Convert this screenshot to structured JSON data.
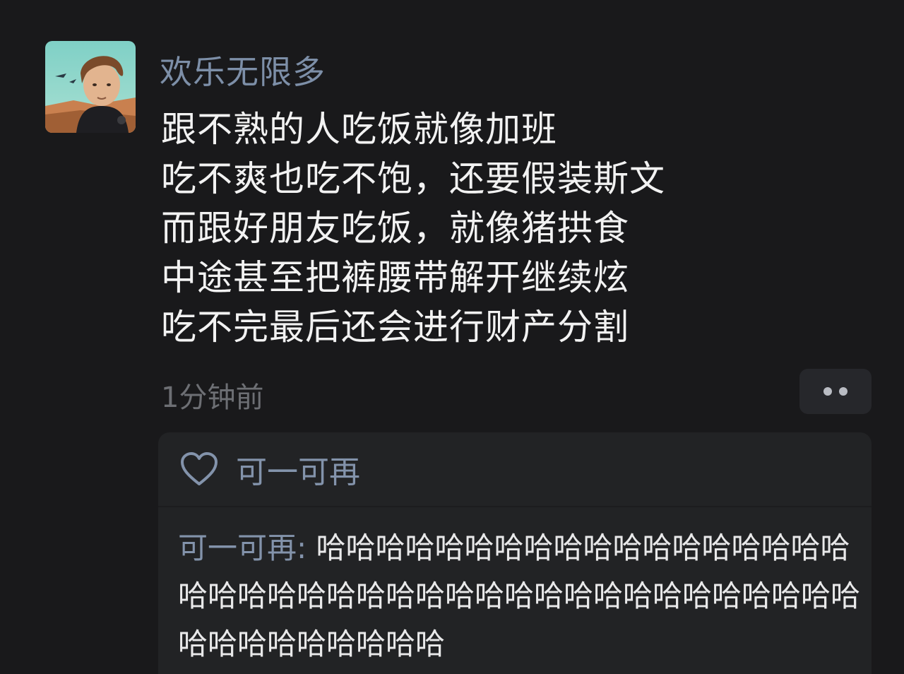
{
  "post": {
    "username": "欢乐无限多",
    "lines": [
      "跟不熟的人吃饭就像加班",
      "吃不爽也吃不饱，还要假装斯文",
      "而跟好朋友吃饭，就像猪拱食",
      "中途甚至把裤腰带解开继续炫",
      "吃不完最后还会进行财产分割"
    ],
    "timestamp": "1分钟前"
  },
  "icons": {
    "avatar": "avatar-image",
    "more": "more-dots-icon",
    "like": "heart-icon"
  },
  "likes": {
    "users": [
      "可一可再"
    ]
  },
  "comments": [
    {
      "author": "可一可再",
      "separator": ": ",
      "text": "哈哈哈哈哈哈哈哈哈哈哈哈哈哈哈哈哈哈哈哈哈哈哈哈哈哈哈哈哈哈哈哈哈哈哈哈哈哈哈哈哈哈哈哈哈哈哈哈哈哈"
    }
  ],
  "colors": {
    "background": "#19191b",
    "username": "#7d8fa8",
    "link": "#8393ab",
    "text": "#f2f2f2",
    "muted": "#6d6f74",
    "card": "#222325"
  }
}
